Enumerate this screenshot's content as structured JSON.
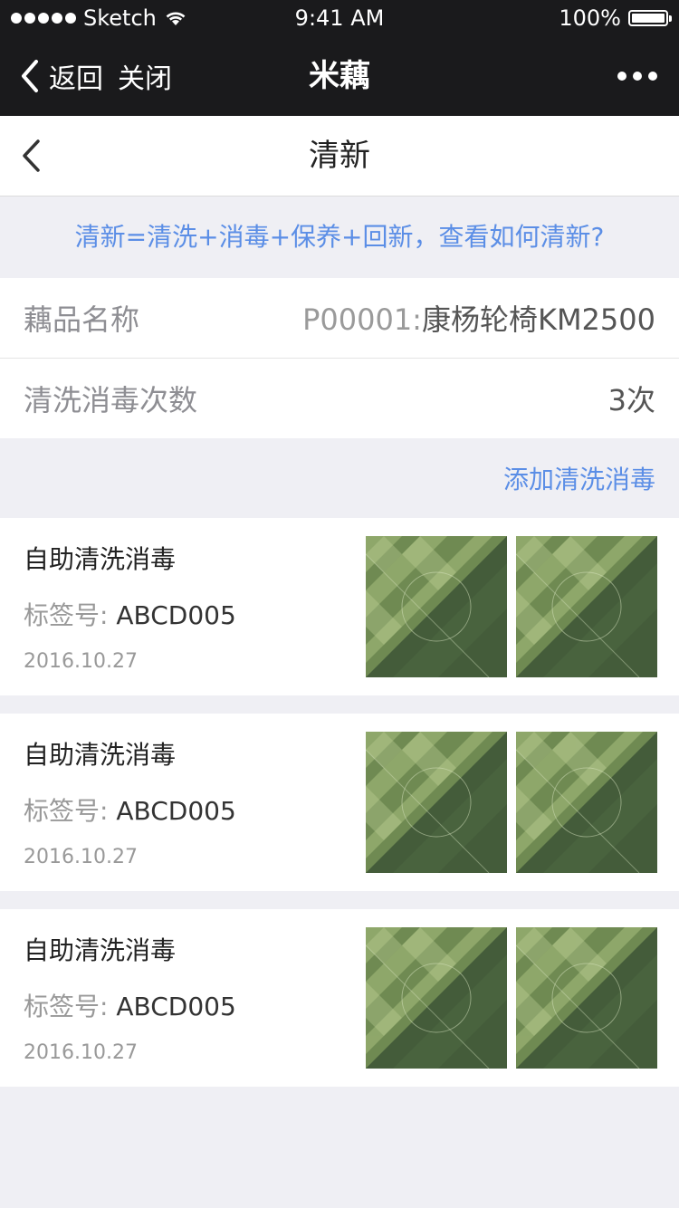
{
  "status_bar": {
    "carrier": "Sketch",
    "time": "9:41 AM",
    "battery": "100%",
    "battery_level": 1.0
  },
  "wechat_nav": {
    "back_label": "返回",
    "close_label": "关闭",
    "title": "米藕"
  },
  "page": {
    "title": "清新"
  },
  "tip": "清新=清洗+消毒+保养+回新，查看如何清新?",
  "product": {
    "label": "藕品名称",
    "code": "P00001:",
    "name": "康杨轮椅KM2500"
  },
  "wash_count": {
    "label": "清洗消毒次数",
    "value": "3次"
  },
  "add_link": "添加清洗消毒",
  "records": [
    {
      "title": "自助清洗消毒",
      "tag_label": "标签号:",
      "tag_value": "ABCD005",
      "date": "2016.10.27"
    },
    {
      "title": "自助清洗消毒",
      "tag_label": "标签号:",
      "tag_value": "ABCD005",
      "date": "2016.10.27"
    },
    {
      "title": "自助清洗消毒",
      "tag_label": "标签号:",
      "tag_value": "ABCD005",
      "date": "2016.10.27"
    }
  ],
  "colors": {
    "accent": "#5b8ee6",
    "nav_bg": "#1a1a1c",
    "page_bg": "#efeff4"
  }
}
